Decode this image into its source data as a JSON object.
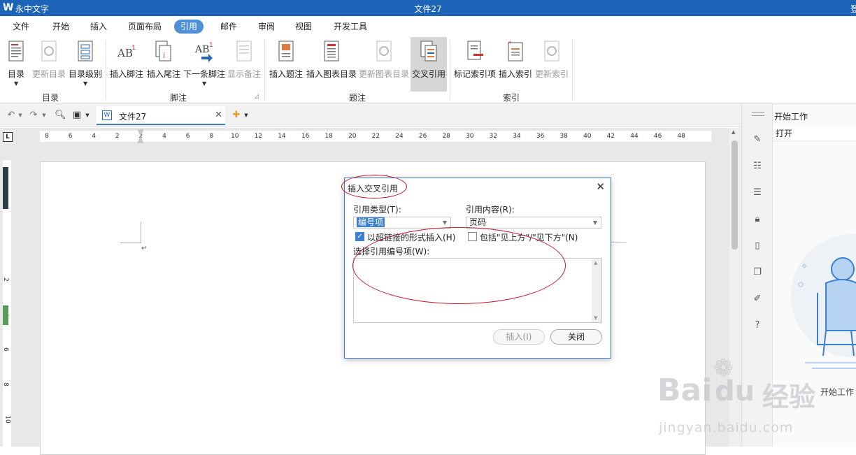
{
  "titlebar": {
    "logo": "W",
    "app_name": "永中文字",
    "doc_title": "文件27",
    "login": "登"
  },
  "menu": [
    "文件",
    "开始",
    "插入",
    "页面布局",
    "引用",
    "邮件",
    "审阅",
    "视图",
    "开发工具"
  ],
  "active_menu": "引用",
  "ribbon": {
    "buttons": {
      "toc": "目录",
      "update_toc": "更新目录",
      "toc_level": "目录级别",
      "insert_footnote": "插入脚注",
      "insert_endnote": "插入尾注",
      "next_footnote": "下一条脚注",
      "show_notes": "显示备注",
      "insert_caption": "插入题注",
      "insert_figure_toc": "插入图表目录",
      "update_figure_toc": "更新图表目录",
      "cross_reference": "交叉引用",
      "mark_index": "标记索引项",
      "insert_index": "插入索引",
      "update_index": "更新索引"
    },
    "groups": {
      "toc": "目录",
      "footnote": "脚注",
      "caption": "题注",
      "index": "索引"
    }
  },
  "doc_tab": {
    "title": "文件27"
  },
  "ruler": {
    "h_numbers": [
      "8",
      "6",
      "4",
      "2",
      "2",
      "4",
      "6",
      "8",
      "10",
      "12",
      "14",
      "16",
      "18",
      "20",
      "22",
      "24",
      "26",
      "28",
      "30",
      "32",
      "34",
      "36",
      "38",
      "40",
      "42",
      "44",
      "46",
      "48"
    ],
    "v_numbers": [
      "2",
      "4",
      "6",
      "8",
      "10"
    ]
  },
  "side_panel": {
    "title": "开始工作",
    "open": "打开",
    "empty_label": "开始工作"
  },
  "dialog": {
    "title": "插入交叉引用",
    "ref_type_label": "引用类型(T):",
    "ref_type_value": "编号项",
    "ref_content_label": "引用内容(R):",
    "ref_content_value": "页码",
    "hyperlink_label": "以超链接的形式插入(H)",
    "hyperlink_checked": true,
    "above_below_label": "包括\"见上方\"/\"见下方\"(N)",
    "above_below_checked": false,
    "list_label": "选择引用编号项(W):",
    "insert_button": "插入(I)",
    "close_button": "关闭"
  },
  "watermark": {
    "brand": "Bai",
    "brand2": "du",
    "cn": "经验",
    "url": "jingyan.baidu.com"
  },
  "colors": {
    "titlebar": "#1d63b8",
    "accent": "#3b7fd1",
    "annotation": "#c0182a"
  }
}
